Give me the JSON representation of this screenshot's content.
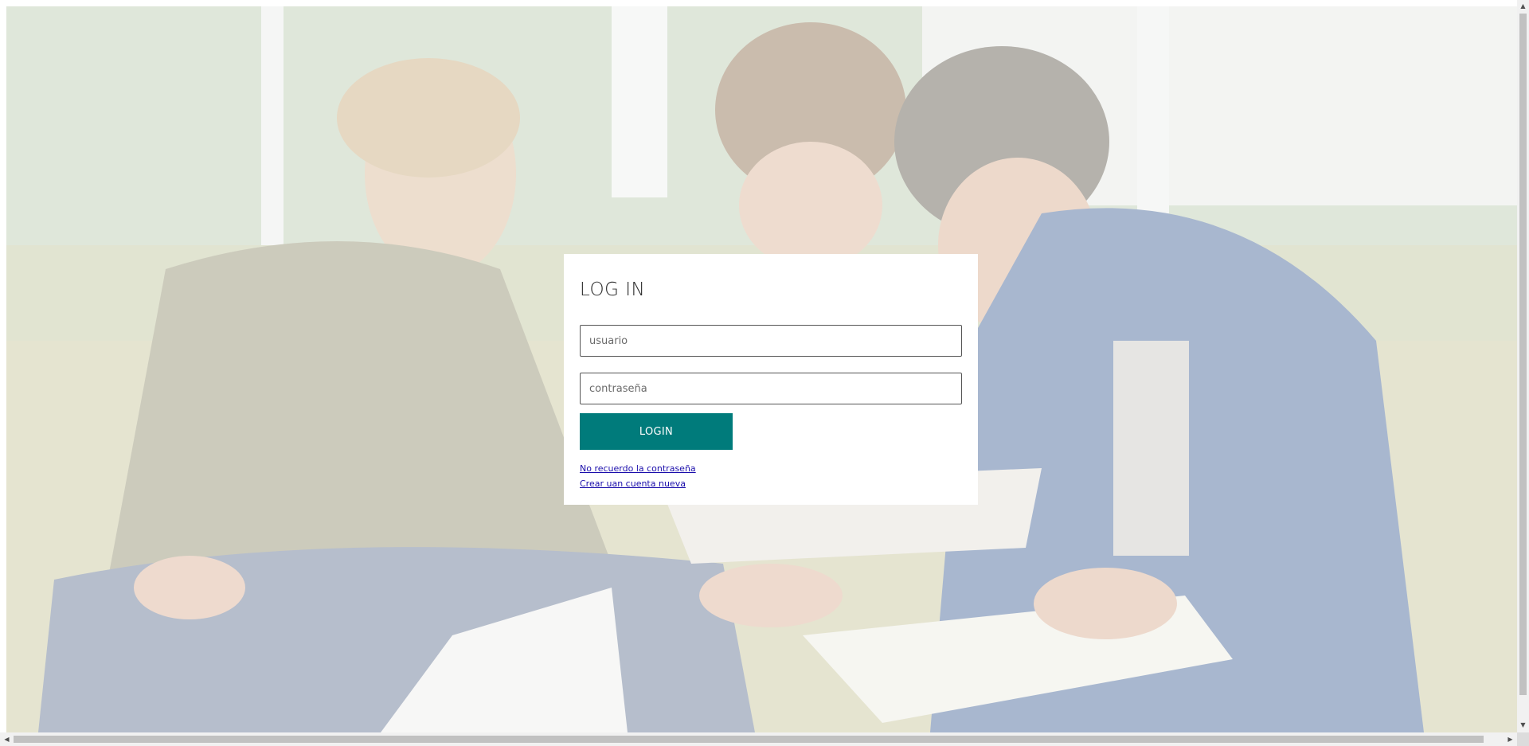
{
  "login": {
    "title": "LOG IN",
    "username_placeholder": "usuario",
    "password_placeholder": "contraseña",
    "button_label": "LOGIN",
    "forgot_password_link": "No recuerdo la contraseña",
    "create_account_link": "Crear uan cuenta nueva"
  },
  "colors": {
    "accent": "#007b7b",
    "link": "#1a0dab"
  },
  "icons": {
    "scroll_up": "up-arrow-icon",
    "scroll_down": "down-arrow-icon",
    "scroll_left": "left-arrow-icon",
    "scroll_right": "right-arrow-icon"
  }
}
